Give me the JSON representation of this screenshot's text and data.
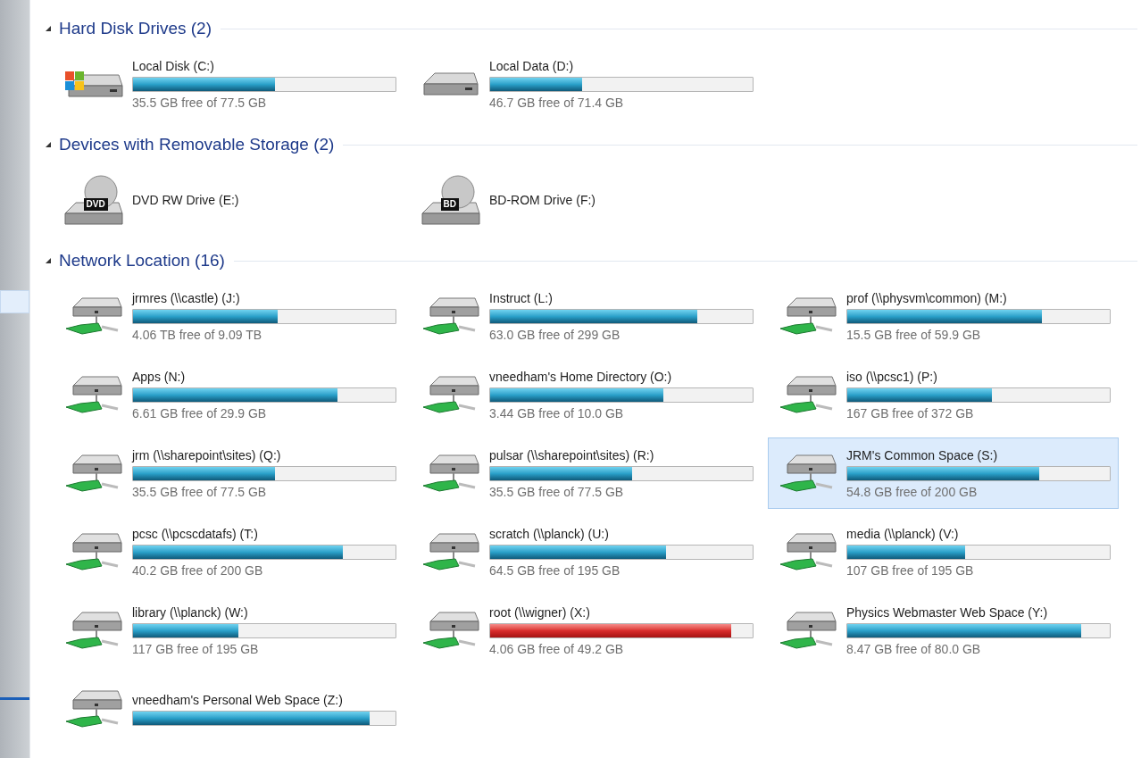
{
  "sections": [
    {
      "title": "Hard Disk Drives (2)",
      "expanded": true,
      "items": [
        {
          "name": "Local Disk (C:)",
          "kind": "system_disk",
          "level": 0.54,
          "free": "35.5 GB free of 77.5 GB",
          "low_space": false,
          "selected": false
        },
        {
          "name": "Local Data (D:)",
          "kind": "disk",
          "level": 0.35,
          "free": "46.7 GB free of 71.4 GB",
          "low_space": false,
          "selected": false
        }
      ]
    },
    {
      "title": "Devices with Removable Storage (2)",
      "expanded": true,
      "items": [
        {
          "name": "DVD RW Drive (E:)",
          "kind": "optical",
          "disc_label": "DVD",
          "selected": false
        },
        {
          "name": "BD-ROM Drive (F:)",
          "kind": "optical",
          "disc_label": "BD",
          "selected": false
        }
      ]
    },
    {
      "title": "Network Location (16)",
      "expanded": true,
      "items": [
        {
          "name": "jrmres (\\\\castle) (J:)",
          "kind": "network",
          "level": 0.55,
          "free": "4.06 TB free of 9.09 TB",
          "low_space": false,
          "selected": false
        },
        {
          "name": "Instruct (L:)",
          "kind": "network",
          "level": 0.79,
          "free": "63.0 GB free of 299 GB",
          "low_space": false,
          "selected": false
        },
        {
          "name": "prof (\\\\physvm\\common) (M:)",
          "kind": "network",
          "level": 0.74,
          "free": "15.5 GB free of 59.9 GB",
          "low_space": false,
          "selected": false
        },
        {
          "name": "Apps (N:)",
          "kind": "network",
          "level": 0.78,
          "free": "6.61 GB free of 29.9 GB",
          "low_space": false,
          "selected": false
        },
        {
          "name": "vneedham's Home Directory (O:)",
          "kind": "network",
          "level": 0.66,
          "free": "3.44 GB free of 10.0 GB",
          "low_space": false,
          "selected": false
        },
        {
          "name": "iso (\\\\pcsc1) (P:)",
          "kind": "network",
          "level": 0.55,
          "free": "167 GB free of 372 GB",
          "low_space": false,
          "selected": false
        },
        {
          "name": "jrm (\\\\sharepoint\\sites) (Q:)",
          "kind": "network",
          "level": 0.54,
          "free": "35.5 GB free of 77.5 GB",
          "low_space": false,
          "selected": false
        },
        {
          "name": "pulsar (\\\\sharepoint\\sites) (R:)",
          "kind": "network",
          "level": 0.54,
          "free": "35.5 GB free of 77.5 GB",
          "low_space": false,
          "selected": false
        },
        {
          "name": "JRM's Common Space (S:)",
          "kind": "network",
          "level": 0.73,
          "free": "54.8 GB free of 200 GB",
          "low_space": false,
          "selected": true
        },
        {
          "name": "pcsc (\\\\pcscdatafs) (T:)",
          "kind": "network",
          "level": 0.8,
          "free": "40.2 GB free of 200 GB",
          "low_space": false,
          "selected": false
        },
        {
          "name": "scratch (\\\\planck) (U:)",
          "kind": "network",
          "level": 0.67,
          "free": "64.5 GB free of 195 GB",
          "low_space": false,
          "selected": false
        },
        {
          "name": "media (\\\\planck) (V:)",
          "kind": "network",
          "level": 0.45,
          "free": "107 GB free of 195 GB",
          "low_space": false,
          "selected": false
        },
        {
          "name": "library (\\\\planck) (W:)",
          "kind": "network",
          "level": 0.4,
          "free": "117 GB free of 195 GB",
          "low_space": false,
          "selected": false
        },
        {
          "name": "root (\\\\wigner) (X:)",
          "kind": "network",
          "level": 0.92,
          "free": "4.06 GB free of 49.2 GB",
          "low_space": true,
          "selected": false
        },
        {
          "name": "Physics Webmaster Web Space (Y:)",
          "kind": "network",
          "level": 0.89,
          "free": "8.47 GB free of 80.0 GB",
          "low_space": false,
          "selected": false
        },
        {
          "name": "vneedham's Personal Web Space (Z:)",
          "kind": "network",
          "level": 0.9,
          "low_space": false,
          "selected": false
        }
      ]
    }
  ]
}
